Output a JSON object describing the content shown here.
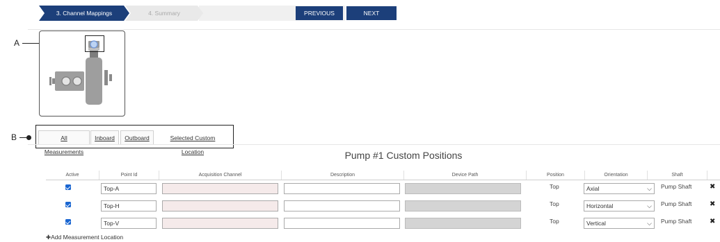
{
  "wizard": {
    "steps": [
      "3. Channel Mappings",
      "4. Summary"
    ],
    "previous_label": "PREVIOUS",
    "next_label": "NEXT"
  },
  "callouts": {
    "a": "A",
    "b": "B"
  },
  "tabs": [
    "All Measurements",
    "Inboard",
    "Outboard",
    "Selected Custom Location"
  ],
  "section_title": "Pump #1 Custom Positions",
  "table": {
    "headers": [
      "Active",
      "Point Id",
      "Acquisition Channel",
      "Description",
      "Device Path",
      "Position",
      "Orientation",
      "Shaft"
    ],
    "rows": [
      {
        "active": true,
        "point_id": "Top-A",
        "acquisition_channel": "",
        "description": "",
        "device_path": "",
        "position": "Top",
        "orientation": "Axial",
        "shaft": "Pump Shaft"
      },
      {
        "active": true,
        "point_id": "Top-H",
        "acquisition_channel": "",
        "description": "",
        "device_path": "",
        "position": "Top",
        "orientation": "Horizontal",
        "shaft": "Pump Shaft"
      },
      {
        "active": true,
        "point_id": "Top-V",
        "acquisition_channel": "",
        "description": "",
        "device_path": "",
        "position": "Top",
        "orientation": "Vertical",
        "shaft": "Pump Shaft"
      }
    ]
  },
  "add_location_label": "Add Measurement Location",
  "colors": {
    "primary": "#1c3f7a",
    "checkbox": "#1a66d1",
    "acquisition_bg": "#f5eaea",
    "device_path_bg": "#d4d4d4"
  }
}
